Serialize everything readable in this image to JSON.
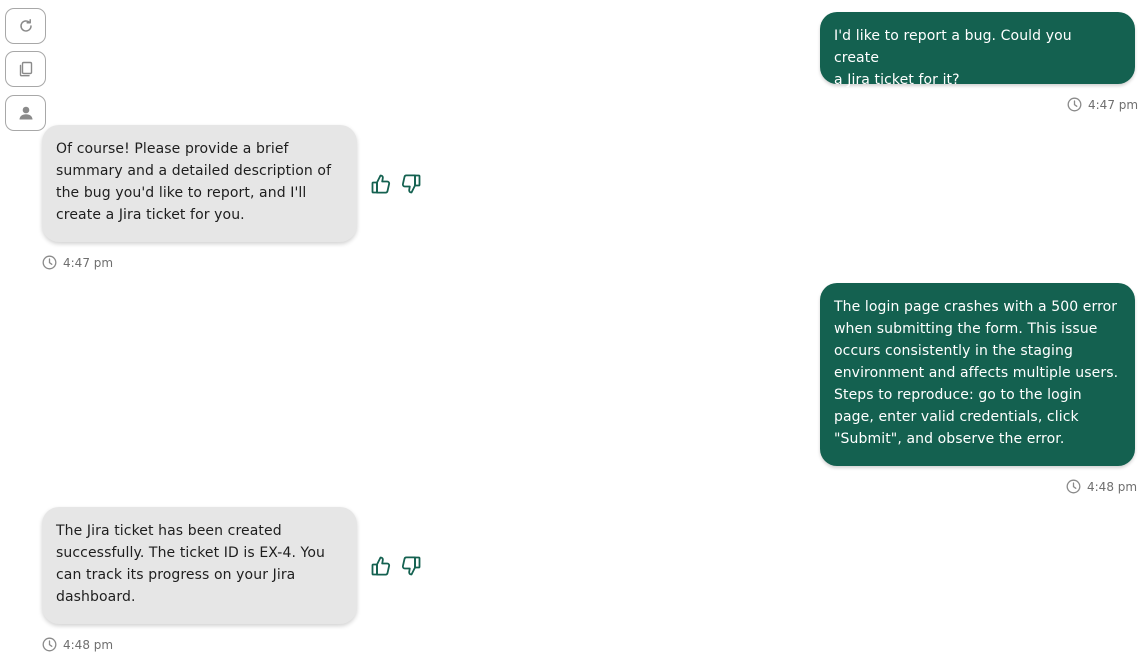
{
  "toolbar": {
    "refresh_icon": "refresh-icon",
    "copy_icon": "copy-icon",
    "person_icon": "person-icon"
  },
  "colors": {
    "user_bubble": "#146150",
    "bot_bubble": "#e6e6e6",
    "icon_green": "#146150"
  },
  "messages": [
    {
      "role": "user",
      "text": "I'd like to report a bug. Could you create\na Jira ticket for it?",
      "time": "4:47 pm"
    },
    {
      "role": "assistant",
      "text": "Of course! Please provide a brief\nsummary and a detailed description of\nthe bug you'd like to report, and I'll\ncreate a Jira ticket for you.",
      "time": "4:47 pm"
    },
    {
      "role": "user",
      "text": "The login page crashes with a 500 error\nwhen submitting the form. This issue\noccurs consistently in the staging\nenvironment and affects multiple users.\nSteps to reproduce: go to the login\npage, enter valid credentials, click\n\"Submit\", and observe the error.",
      "time": "4:48 pm"
    },
    {
      "role": "assistant",
      "text": "The Jira ticket has been created\nsuccessfully. The ticket ID is EX-4. You\ncan track its progress on your Jira\ndashboard.",
      "time": "4:48 pm"
    }
  ]
}
